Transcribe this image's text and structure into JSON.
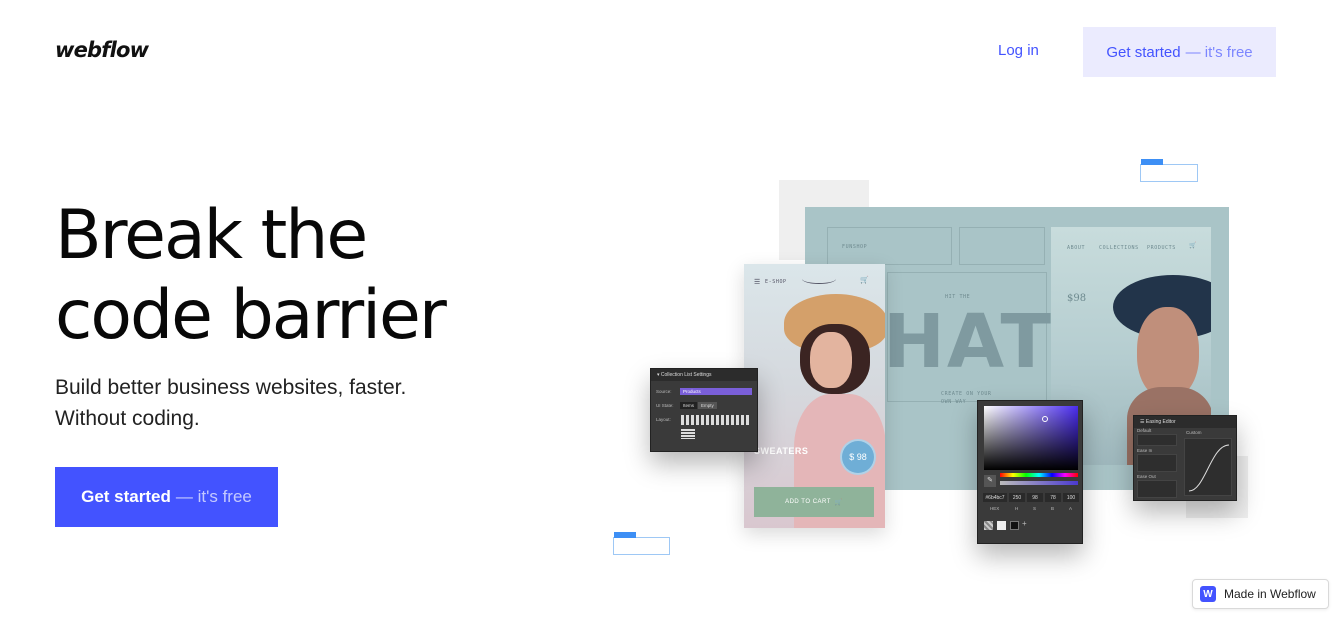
{
  "header": {
    "logo_text": "webflow",
    "login_label": "Log in",
    "cta_label": "Get started",
    "cta_suffix": "— it's free"
  },
  "hero": {
    "title_line1": "Break the",
    "title_line2": "code barrier",
    "subtitle_line1": "Build better business websites, faster.",
    "subtitle_line2": "Without coding.",
    "cta_label": "Get started",
    "cta_suffix": "— it's free"
  },
  "illustration": {
    "site_brand": "FUNSHOP",
    "site_nav": [
      "ABOUT",
      "COLLECTIONS",
      "PRODUCTS"
    ],
    "site_kicker": "HIT THE",
    "site_headline": "HATS",
    "site_tagline_1": "CREATE ON YOUR",
    "site_tagline_2": "OWN WAY",
    "product_price": "$98",
    "phone_shop": "E-SHOP",
    "phone_category": "SWEATERS",
    "phone_price": "$ 98",
    "phone_add_to_cart": "ADD TO CART",
    "collection_panel": {
      "title": "Collection List Settings",
      "source_label": "Source:",
      "source_value": "Products",
      "state_label": "UI State:",
      "state_items": "Items",
      "state_empty": "Empty",
      "layout_label": "Layout:"
    },
    "color_picker": {
      "hex_value": "#6b4bc7",
      "values": [
        "250",
        "98",
        "78",
        "100"
      ],
      "modes": [
        "HEX",
        "H",
        "S",
        "B",
        "A"
      ]
    },
    "easing_panel": {
      "title": "Easing Editor",
      "groups": [
        "Default",
        "Ease In",
        "Ease Out"
      ],
      "custom_label": "Custom"
    }
  },
  "badge": {
    "logo_letter": "W",
    "label": "Made in Webflow"
  },
  "colors": {
    "brand_blue": "#4353ff",
    "light_button": "#ebebfe"
  }
}
